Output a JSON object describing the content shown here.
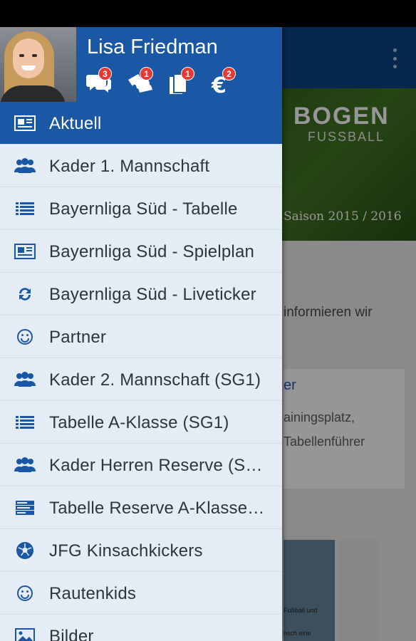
{
  "colors": {
    "accent": "#1a58a6",
    "app_bar": "#0b3d7a",
    "drawer_bg": "#e4ecf5",
    "icon": "#1a58a6",
    "badge": "#e53935"
  },
  "user": {
    "name": "Lisa Friedman"
  },
  "badges": [
    {
      "icon": "chat-icon",
      "count": "3"
    },
    {
      "icon": "ticket-icon",
      "count": "1"
    },
    {
      "icon": "documents-icon",
      "count": "1"
    },
    {
      "icon": "euro-icon",
      "count": "2"
    }
  ],
  "menu": [
    {
      "label": "Aktuell",
      "icon": "newspaper-icon",
      "active": true
    },
    {
      "label": "Kader 1. Mannschaft",
      "icon": "group-icon"
    },
    {
      "label": "Bayernliga Süd - Tabelle",
      "icon": "list-icon"
    },
    {
      "label": "Bayernliga Süd - Spielplan",
      "icon": "newspaper-icon"
    },
    {
      "label": "Bayernliga Süd - Liveticker",
      "icon": "refresh-icon"
    },
    {
      "label": "Partner",
      "icon": "smiley-icon"
    },
    {
      "label": "Kader 2. Mannschaft (SG1)",
      "icon": "group-icon"
    },
    {
      "label": "Tabelle A-Klasse (SG1)",
      "icon": "list-icon"
    },
    {
      "label": "Kader Herren Reserve (SG…",
      "icon": "group-icon"
    },
    {
      "label": "Tabelle Reserve A-Klasse…",
      "icon": "table-icon"
    },
    {
      "label": "JFG Kinsachkickers",
      "icon": "soccer-ball-icon"
    },
    {
      "label": "Rautenkids",
      "icon": "smiley-icon"
    },
    {
      "label": "Bilder",
      "icon": "image-icon"
    }
  ],
  "background": {
    "hero_title": "BOGEN",
    "hero_subtitle": "FUSSBALL",
    "season": "Saison 2015 / 2016",
    "text_line1": "informieren wir",
    "text_line2": "",
    "card_title": "er",
    "card_line1": "ainingsplatz,",
    "card_line2": "Tabellenführer",
    "news_line1": "Fußball und",
    "news_line2": "nsch eine"
  }
}
